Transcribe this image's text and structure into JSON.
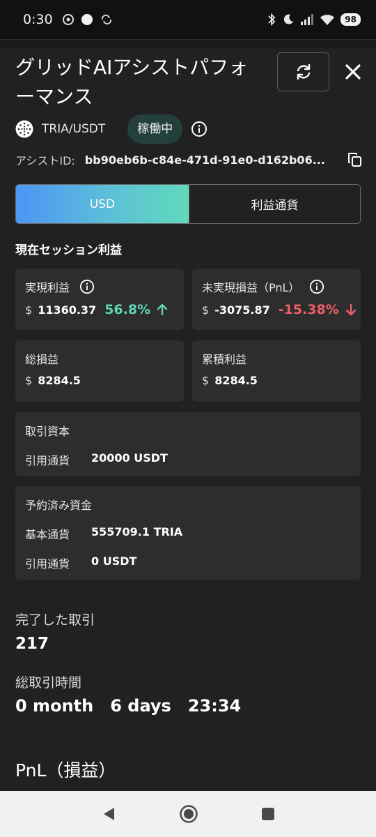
{
  "status_bar": {
    "time": "0:30",
    "battery": "98"
  },
  "header": {
    "title": "グリッドAIアシストパフォーマンス",
    "pair": "TRIA/USDT",
    "status": "稼働中",
    "assist_id_label": "アシストID:",
    "assist_id": "bb90eb6b-c84e-471d-91e0-d162b06..."
  },
  "toggle": {
    "usd_label": "USD",
    "base_label": "利益通貨"
  },
  "session": {
    "title": "現在セッション利益",
    "realized": {
      "label": "実現利益",
      "currency": "$",
      "value": "11360.37",
      "pct": "56.8%"
    },
    "unrealized": {
      "label": "未実現損益（PnL）",
      "currency": "$",
      "value": "-3075.87",
      "pct": "-15.38%"
    },
    "total": {
      "label": "総損益",
      "currency": "$",
      "value": "8284.5"
    },
    "cumulative": {
      "label": "累積利益",
      "currency": "$",
      "value": "8284.5"
    }
  },
  "capital": {
    "title": "取引資本",
    "quote_label": "引用通貨",
    "quote_value": "20000 USDT"
  },
  "reserved": {
    "title": "予約済み資金",
    "base_label": "基本通貨",
    "base_value": "555709.1 TRIA",
    "quote_label": "引用通貨",
    "quote_value": "0 USDT"
  },
  "stats": {
    "trades_label": "完了した取引",
    "trades_value": "217",
    "duration_label": "総取引時間",
    "duration_months": "0 month",
    "duration_days": "6 days",
    "duration_time": "23:34"
  },
  "pnl_title": "PnL（損益）",
  "colors": {
    "background": "#212121",
    "card": "#2d2d2d",
    "positive": "#5fd6b4",
    "negative": "#ef5f66",
    "accent_gradient_start": "#4d95f3",
    "accent_gradient_end": "#60d9bb"
  },
  "icons": [
    "chrome-icon",
    "record-dot-icon",
    "sync-icon",
    "bluetooth-icon",
    "moon-icon",
    "signal-icon",
    "wifi-icon",
    "refresh-icon",
    "close-icon",
    "coin-logo-icon",
    "info-icon",
    "copy-icon",
    "arrow-up-icon",
    "arrow-down-icon",
    "back-icon",
    "home-icon",
    "recents-icon"
  ]
}
